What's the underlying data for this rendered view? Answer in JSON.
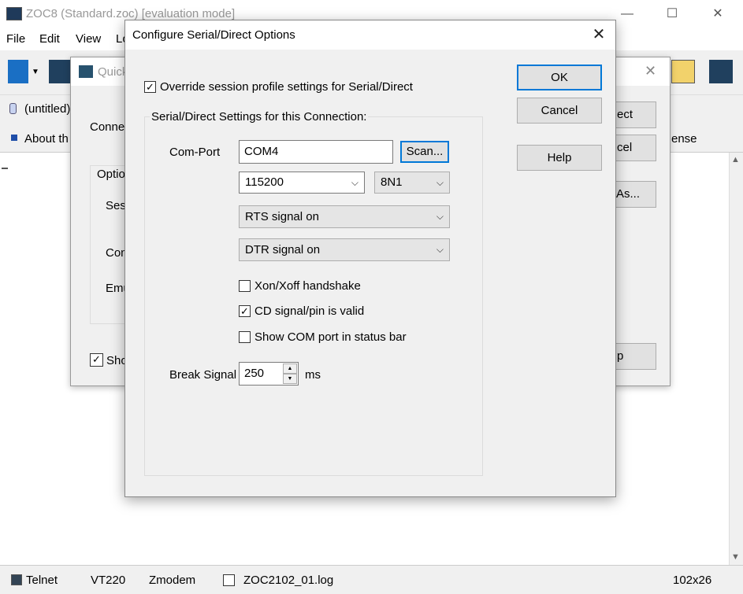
{
  "main_window": {
    "title": "ZOC8 (Standard.zoc) [evaluation mode]",
    "menus": [
      "File",
      "Edit",
      "View",
      "Lo"
    ],
    "tab_label": "(untitled)",
    "bookmark_label": "About th",
    "bookmark_right": "ense"
  },
  "quick_connect": {
    "title": "Quick",
    "connect_label": "Connec",
    "options_label": "Optio",
    "session_label": "Sess",
    "connection_label": "Con",
    "emulation_label": "Emu",
    "show_label": "Sho",
    "btn_connect": "ect",
    "btn_cancel": "cel",
    "btn_saveas": "As...",
    "btn_help": "p"
  },
  "dialog": {
    "title": "Configure Serial/Direct Options",
    "override_label": "Override session profile settings for Serial/Direct",
    "override_checked": true,
    "group_label": "Serial/Direct Settings for this Connection:",
    "comport_label": "Com-Port",
    "comport_value": "COM4",
    "scan_label": "Scan...",
    "baud_value": "115200",
    "format_value": "8N1",
    "rts_value": "RTS signal on",
    "dtr_value": "DTR signal on",
    "xon_label": "Xon/Xoff handshake",
    "xon_checked": false,
    "cd_label": "CD signal/pin is valid",
    "cd_checked": true,
    "showcom_label": "Show COM port in status bar",
    "showcom_checked": false,
    "break_label": "Break Signal",
    "break_value": "250",
    "break_unit": "ms",
    "ok_label": "OK",
    "cancel_label": "Cancel",
    "help_label": "Help"
  },
  "statusbar": {
    "protocol": "Telnet",
    "emulation": "VT220",
    "transfer": "Zmodem",
    "logfile": "ZOC2102_01.log",
    "size": "102x26"
  },
  "glyphs": {
    "close": "✕",
    "maximize": "☐",
    "minimize": "—",
    "chevron": "⌵",
    "check": "✓",
    "spin_up": "▲",
    "spin_down": "▼"
  }
}
